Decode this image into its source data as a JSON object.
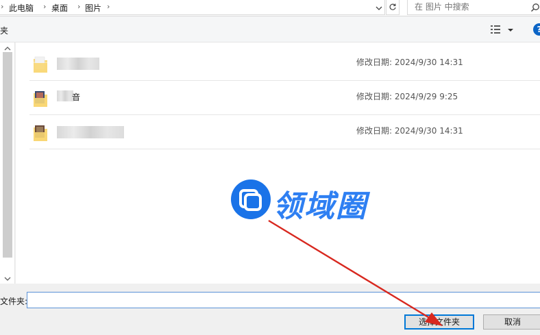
{
  "address_bar": {
    "breadcrumbs": [
      "此电脑",
      "桌面",
      "图片"
    ],
    "dropdown_icon": "chevron-down-icon",
    "refresh_icon": "refresh-icon"
  },
  "search": {
    "placeholder": "在 图片 中搜索",
    "icon": "search-icon"
  },
  "toolbar": {
    "new_folder_label": "夹",
    "view_icon": "view-details-icon",
    "help_label": "?"
  },
  "file_list": {
    "rows": [
      {
        "name_visible": "",
        "date": "修改日期: 2024/9/30 14:31",
        "icon": "folder-icon"
      },
      {
        "name_visible": "音",
        "date": "修改日期: 2024/9/29 9:25",
        "icon": "folder-icon"
      },
      {
        "name_visible": "",
        "date": "修改日期: 2024/9/30 14:31",
        "icon": "folder-icon"
      }
    ]
  },
  "watermark": {
    "text": "领域圈"
  },
  "bottom": {
    "folder_label": "文件夹:",
    "folder_value": "",
    "select_button": "选择文件夹",
    "cancel_button": "取消"
  },
  "colors": {
    "accent": "#0078d7",
    "watermark_blue": "#1a73e8",
    "arrow_red": "#d8281f"
  }
}
